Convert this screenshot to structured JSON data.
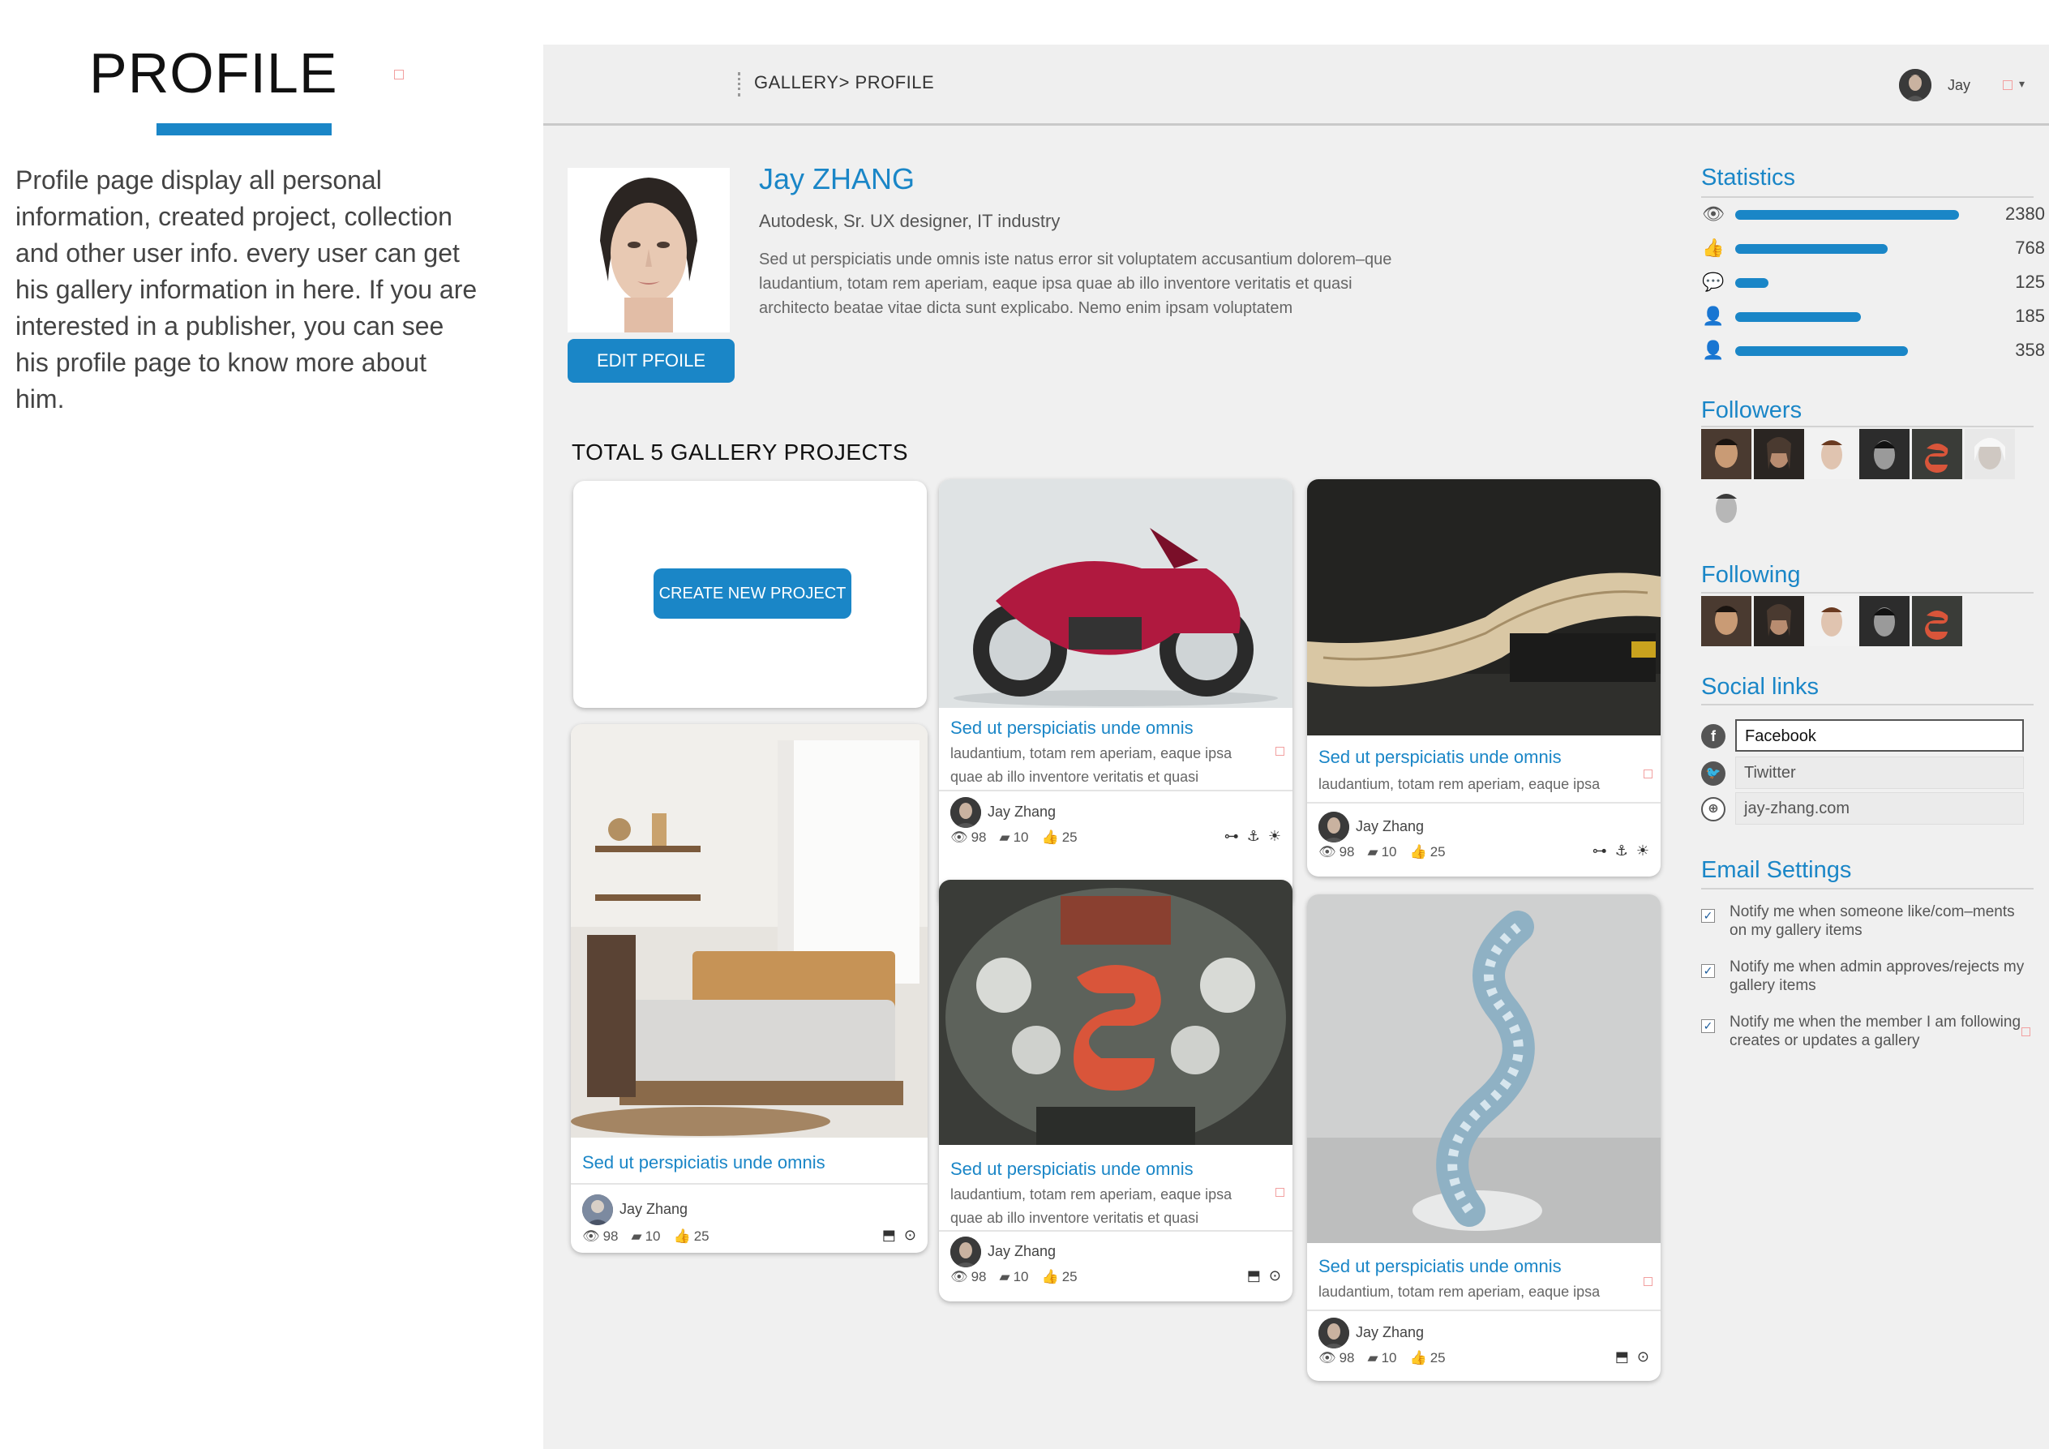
{
  "description": {
    "title": "PROFILE",
    "text": "Profile page display all personal information, created project, collection and other user info. every user can get his gallery information in here. If you are interested in a publisher, you can see his profile page to know more about him."
  },
  "topbar": {
    "breadcrumb": "GALLERY> PROFILE",
    "user_name": "Jay",
    "caret": "▾"
  },
  "profile": {
    "name": "Jay ZHANG",
    "role": "Autodesk, Sr. UX designer, IT industry",
    "bio": "Sed ut perspiciatis unde omnis iste natus error sit voluptatem accusantium dolorem–que laudantium, totam rem aperiam, eaque ipsa quae ab illo inventore veritatis et quasi architecto beatae vitae dicta sunt explicabo. Nemo enim ipsam voluptatem",
    "edit_label": "EDIT PFOILE"
  },
  "gallery": {
    "total_label": "TOTAL 5 GALLERY PROJECTS",
    "create_label": "CREATE NEW PROJECT",
    "cards": [
      {
        "title": "Sed ut perspiciatis unde omnis",
        "desc": "",
        "author": "Jay Zhang",
        "views": "98",
        "comments": "10",
        "likes": "25"
      },
      {
        "title": "Sed ut perspiciatis unde omnis",
        "desc": "laudantium, totam rem aperiam, eaque ipsa quae ab illo inventore veritatis et quasi",
        "author": "Jay Zhang",
        "views": "98",
        "comments": "10",
        "likes": "25"
      },
      {
        "title": "Sed ut perspiciatis unde omnis",
        "desc": "laudantium, totam rem aperiam, eaque ipsa quae ab illo inventore veritatis et quasi",
        "author": "Jay Zhang",
        "views": "98",
        "comments": "10",
        "likes": "25"
      },
      {
        "title": "Sed ut perspiciatis unde omnis",
        "desc": "laudantium, totam rem aperiam, eaque ipsa",
        "author": "Jay Zhang",
        "views": "98",
        "comments": "10",
        "likes": "25"
      },
      {
        "title": "Sed ut perspiciatis unde omnis",
        "desc": "laudantium, totam rem aperiam, eaque ipsa",
        "author": "Jay Zhang",
        "views": "98",
        "comments": "10",
        "likes": "25"
      }
    ]
  },
  "sidebar": {
    "statistics_title": "Statistics",
    "stats": [
      {
        "icon": "eye-icon",
        "value": "2380",
        "fraction": 1.0
      },
      {
        "icon": "thumbs-up-icon",
        "value": "768",
        "fraction": 0.68
      },
      {
        "icon": "comment-icon",
        "value": "125",
        "fraction": 0.15
      },
      {
        "icon": "user-add-icon",
        "value": "185",
        "fraction": 0.56
      },
      {
        "icon": "user-add-icon",
        "value": "358",
        "fraction": 0.77
      }
    ],
    "followers_title": "Followers",
    "following_title": "Following",
    "social_title": "Social links",
    "social": [
      {
        "icon": "facebook-icon",
        "value": "Facebook"
      },
      {
        "icon": "twitter-icon",
        "value": "Tiwitter"
      },
      {
        "icon": "web-icon",
        "value": "jay-zhang.com"
      }
    ],
    "email_title": "Email Settings",
    "email_options": [
      {
        "label": "Notify me when someone like/com–ments on my gallery items",
        "checked": true
      },
      {
        "label": "Notify me when admin approves/rejects my gallery items",
        "checked": true
      },
      {
        "label": "Notify me when the member I am following creates or updates a gallery",
        "checked": true
      }
    ]
  },
  "colors": {
    "accent": "#1a86c7",
    "background": "#f0f0f0"
  }
}
